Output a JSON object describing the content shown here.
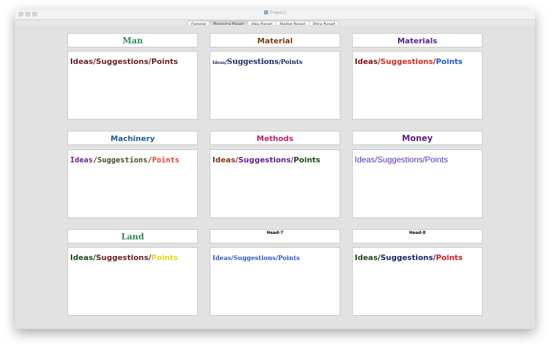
{
  "window": {
    "title": "Project 1"
  },
  "tabs": [
    {
      "label": "General",
      "selected": false
    },
    {
      "label": "Resource Based",
      "selected": true
    },
    {
      "label": "Idea Based",
      "selected": false
    },
    {
      "label": "Market Based",
      "selected": false
    },
    {
      "label": "Price Based",
      "selected": false
    }
  ],
  "cards": [
    {
      "heading": "Man",
      "heading_color": "#2e8b57",
      "text": {
        "w1": "Ideas",
        "s1": "/",
        "w2": "Suggestions",
        "s2": "/",
        "w3": "Points"
      },
      "colors": {
        "w1": "#6b1f2a",
        "s1": "#6b1f2a",
        "w2": "#6b1f2a",
        "s2": "#6b1f2a",
        "w3": "#6b1f2a"
      }
    },
    {
      "heading": "Material",
      "heading_color": "#7a3e14",
      "text": {
        "w1": "Ideas",
        "s1": "/",
        "w2": "Suggestions",
        "s2": "/",
        "w3": "Points"
      },
      "colors": {
        "w1": "#1a2466",
        "s1": "#1a2466",
        "w2": "#1a2466",
        "s2": "#1a2466",
        "w3": "#1a2466"
      }
    },
    {
      "heading": "Materials",
      "heading_color": "#5a1f8a",
      "text": {
        "w1": "Ideas",
        "s1": "/",
        "w2": "Suggestions",
        "s2": "/",
        "w3": "Points"
      },
      "colors": {
        "w1": "#7a1414",
        "s1": "#7a1414",
        "w2": "#d42c1c",
        "s2": "#7a1414",
        "w3": "#1c5cd4"
      }
    },
    {
      "heading": "Machinery",
      "heading_color": "#1f5f8a",
      "text": {
        "w1": "Ideas",
        "s1": "/",
        "w2": "Suggestions",
        "s2": "/",
        "w3": "Points"
      },
      "colors": {
        "w1": "#6a1f8a",
        "s1": "#4a4a1a",
        "w2": "#4a4a1a",
        "s2": "#4a4a1a",
        "w3": "#e83a1c"
      }
    },
    {
      "heading": "Methods",
      "heading_color": "#c41f6a",
      "text": {
        "w1": "Ideas",
        "s1": "/",
        "w2": "Suggestions",
        "s2": "/",
        "w3": "Points"
      },
      "colors": {
        "w1": "#8a3a14",
        "s1": "#8a3a14",
        "w2": "#6a1f8a",
        "s2": "#6a1f8a",
        "w3": "#1f4a1f"
      }
    },
    {
      "heading": "Money",
      "heading_color": "#5a1f8a",
      "text": {
        "w1": "Ideas",
        "s1": "/",
        "w2": "Suggestions",
        "s2": "/",
        "w3": "Points"
      },
      "colors": {
        "w1": "#5a2ab4",
        "s1": "#5a2ab4",
        "w2": "#5a2ab4",
        "s2": "#5a2ab4",
        "w3": "#5a2ab4"
      }
    },
    {
      "heading": "Land",
      "heading_color": "#2e8b57",
      "text": {
        "w1": "Ideas",
        "s1": "/",
        "w2": "Suggestions",
        "s2": "/",
        "w3": "Points"
      },
      "colors": {
        "w1": "#1f4a1f",
        "s1": "#1f4a1f",
        "w2": "#6b1f2a",
        "s2": "#6b1f2a",
        "w3": "#e8d41c"
      }
    },
    {
      "heading": "Head-7",
      "heading_color": "#000000",
      "text": {
        "w1": "Ideas",
        "s1": "/",
        "w2": "Suggestions",
        "s2": "/",
        "w3": "Points"
      },
      "colors": {
        "w1": "#2a5ac4",
        "s1": "#2a5ac4",
        "w2": "#2a5ac4",
        "s2": "#2a5ac4",
        "w3": "#2a5ac4"
      }
    },
    {
      "heading": "Head-8",
      "heading_color": "#000000",
      "text": {
        "w1": "Ideas",
        "s1": "/",
        "w2": "Suggestions",
        "s2": "/",
        "w3": "Points"
      },
      "colors": {
        "w1": "#1f4a1f",
        "s1": "#1f4a1f",
        "w2": "#1a2466",
        "s2": "#1a2466",
        "w3": "#d41c1c"
      }
    }
  ]
}
